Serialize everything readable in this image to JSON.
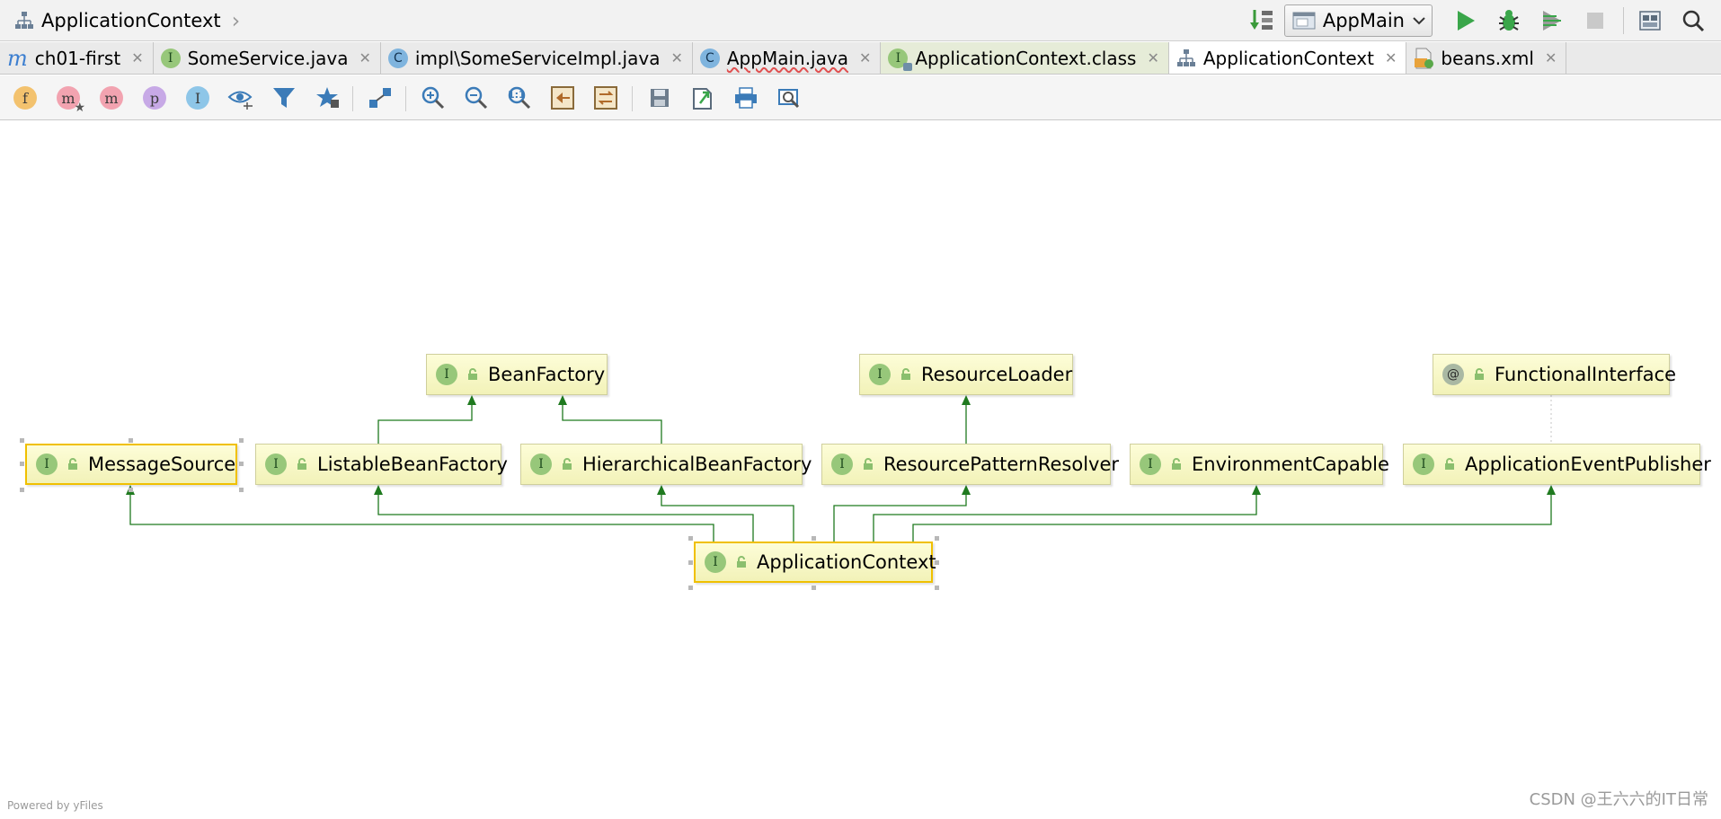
{
  "navbar": {
    "breadcrumb": "ApplicationContext",
    "run_config": "AppMain"
  },
  "tabs": [
    {
      "label": "ch01-first",
      "icon": "module-icon"
    },
    {
      "label": "SomeService.java",
      "icon": "interface-icon"
    },
    {
      "label": "impl\\SomeServiceImpl.java",
      "icon": "class-icon"
    },
    {
      "label": "AppMain.java",
      "icon": "class-run-icon"
    },
    {
      "label": "ApplicationContext.class",
      "icon": "interface-icon"
    },
    {
      "label": "ApplicationContext",
      "icon": "diagram-icon"
    },
    {
      "label": "beans.xml",
      "icon": "xml-icon"
    }
  ],
  "diagram_toolbar": {
    "fields": "f",
    "constructors": "m",
    "methods": "m",
    "properties": "p",
    "inner_classes": "I",
    "zoom_actual": "1:1"
  },
  "diagram": {
    "nodes": [
      {
        "id": "BeanFactory",
        "label": "BeanFactory",
        "kind": "I"
      },
      {
        "id": "ResourceLoader",
        "label": "ResourceLoader",
        "kind": "I"
      },
      {
        "id": "FunctionalInterface",
        "label": "FunctionalInterface",
        "kind": "@"
      },
      {
        "id": "MessageSource",
        "label": "MessageSource",
        "kind": "I"
      },
      {
        "id": "ListableBeanFactory",
        "label": "ListableBeanFactory",
        "kind": "I"
      },
      {
        "id": "HierarchicalBeanFactory",
        "label": "HierarchicalBeanFactory",
        "kind": "I"
      },
      {
        "id": "ResourcePatternResolver",
        "label": "ResourcePatternResolver",
        "kind": "I"
      },
      {
        "id": "EnvironmentCapable",
        "label": "EnvironmentCapable",
        "kind": "I"
      },
      {
        "id": "ApplicationEventPublisher",
        "label": "ApplicationEventPublisher",
        "kind": "I"
      },
      {
        "id": "ApplicationContext",
        "label": "ApplicationContext",
        "kind": "I"
      }
    ],
    "edges": [
      {
        "from": "ApplicationContext",
        "to": "MessageSource",
        "type": "extends"
      },
      {
        "from": "ApplicationContext",
        "to": "ListableBeanFactory",
        "type": "extends"
      },
      {
        "from": "ApplicationContext",
        "to": "HierarchicalBeanFactory",
        "type": "extends"
      },
      {
        "from": "ApplicationContext",
        "to": "ResourcePatternResolver",
        "type": "extends"
      },
      {
        "from": "ApplicationContext",
        "to": "EnvironmentCapable",
        "type": "extends"
      },
      {
        "from": "ApplicationContext",
        "to": "ApplicationEventPublisher",
        "type": "extends"
      },
      {
        "from": "ListableBeanFactory",
        "to": "BeanFactory",
        "type": "extends"
      },
      {
        "from": "HierarchicalBeanFactory",
        "to": "BeanFactory",
        "type": "extends"
      },
      {
        "from": "ResourcePatternResolver",
        "to": "ResourceLoader",
        "type": "extends"
      },
      {
        "from": "ApplicationEventPublisher",
        "to": "FunctionalInterface",
        "type": "annotation"
      }
    ]
  },
  "footer": {
    "powered_by": "Powered by yFiles",
    "watermark": "CSDN @王六六的IT日常"
  },
  "colors": {
    "edge": "#1f7a1f",
    "node_fill": "#f7f7c6",
    "selection": "#f0c000",
    "run": "#3aa64a"
  }
}
